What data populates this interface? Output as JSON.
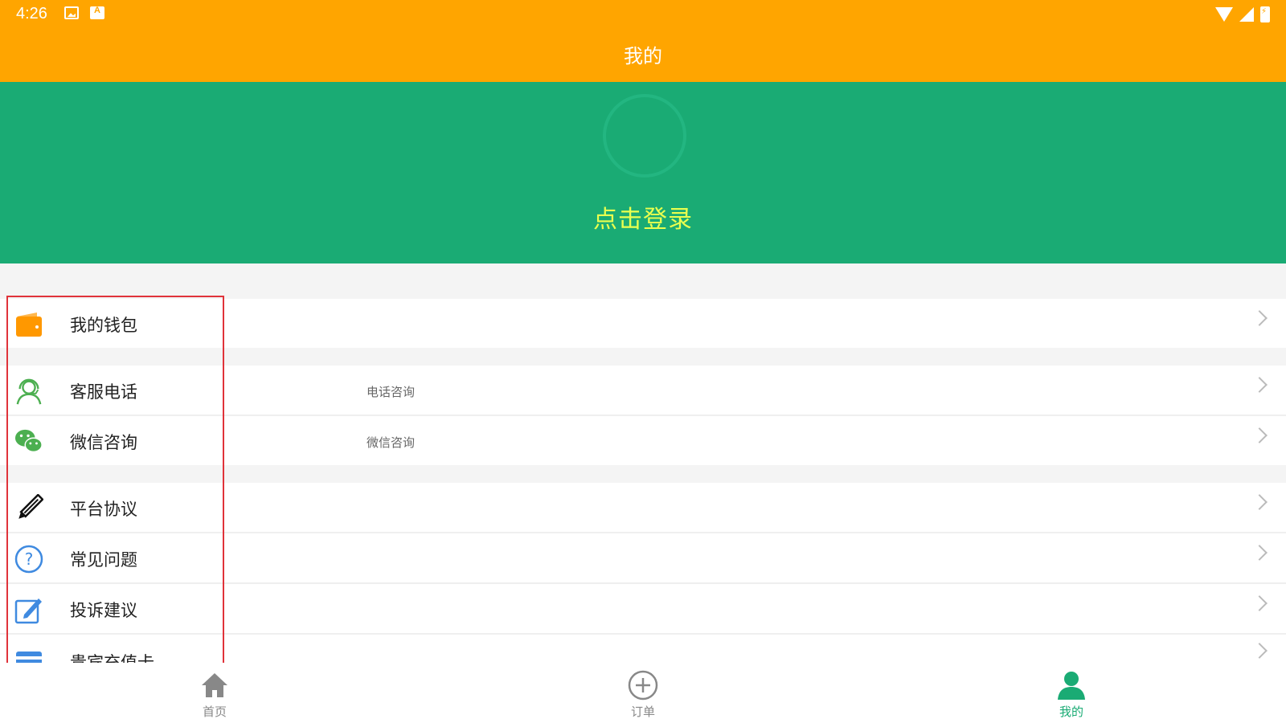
{
  "status_bar": {
    "time": "4:26"
  },
  "header": {
    "title": "我的"
  },
  "profile": {
    "login_label": "点击登录"
  },
  "menu": {
    "items": [
      {
        "label": "我的钱包",
        "sub": "",
        "icon": "wallet-icon",
        "icon_color": "#FF9800"
      },
      {
        "label": "客服电话",
        "sub": "电话咨询",
        "icon": "headset-agent-icon",
        "icon_color": "#4CAF50"
      },
      {
        "label": "微信咨询",
        "sub": "微信咨询",
        "icon": "wechat-icon",
        "icon_color": "#4CAF50"
      },
      {
        "label": "平台协议",
        "sub": "",
        "icon": "pencil-icon",
        "icon_color": "#111111"
      },
      {
        "label": "常见问题",
        "sub": "",
        "icon": "question-circle-icon",
        "icon_color": "#3F8AE0"
      },
      {
        "label": "投诉建议",
        "sub": "",
        "icon": "edit-square-icon",
        "icon_color": "#3F8AE0"
      },
      {
        "label": "贵宾充值卡",
        "sub": "",
        "icon": "card-icon",
        "icon_color": "#3F8AE0"
      }
    ]
  },
  "tabbar": {
    "tabs": [
      {
        "label": "首页",
        "icon": "home-icon",
        "active": false
      },
      {
        "label": "订单",
        "icon": "plus-circle-icon",
        "active": false
      },
      {
        "label": "我的",
        "icon": "person-icon",
        "active": true
      }
    ]
  },
  "colors": {
    "header": "#FFA500",
    "profile_bg": "#1AAB74",
    "login_text": "#E9FF4F",
    "highlight": "#E0333A"
  }
}
